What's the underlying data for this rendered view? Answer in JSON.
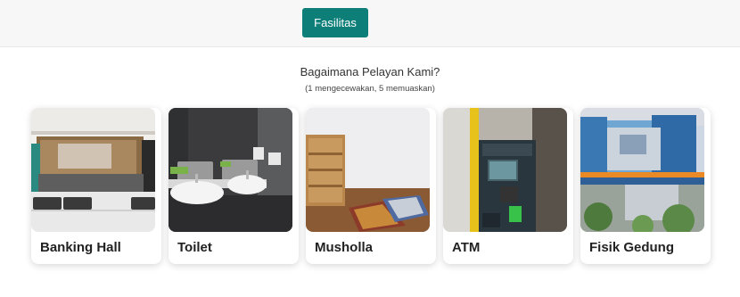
{
  "nav": {
    "active_tab": "Fasilitas"
  },
  "survey": {
    "question": "Bagaimana Pelayan Kami?",
    "scale_hint": "(1 mengecewakan, 5 memuaskan)"
  },
  "cards": [
    {
      "label": "Banking Hall"
    },
    {
      "label": "Toilet"
    },
    {
      "label": "Musholla"
    },
    {
      "label": "ATM"
    },
    {
      "label": "Fisik Gedung"
    }
  ],
  "colors": {
    "accent": "#0d7f78"
  }
}
